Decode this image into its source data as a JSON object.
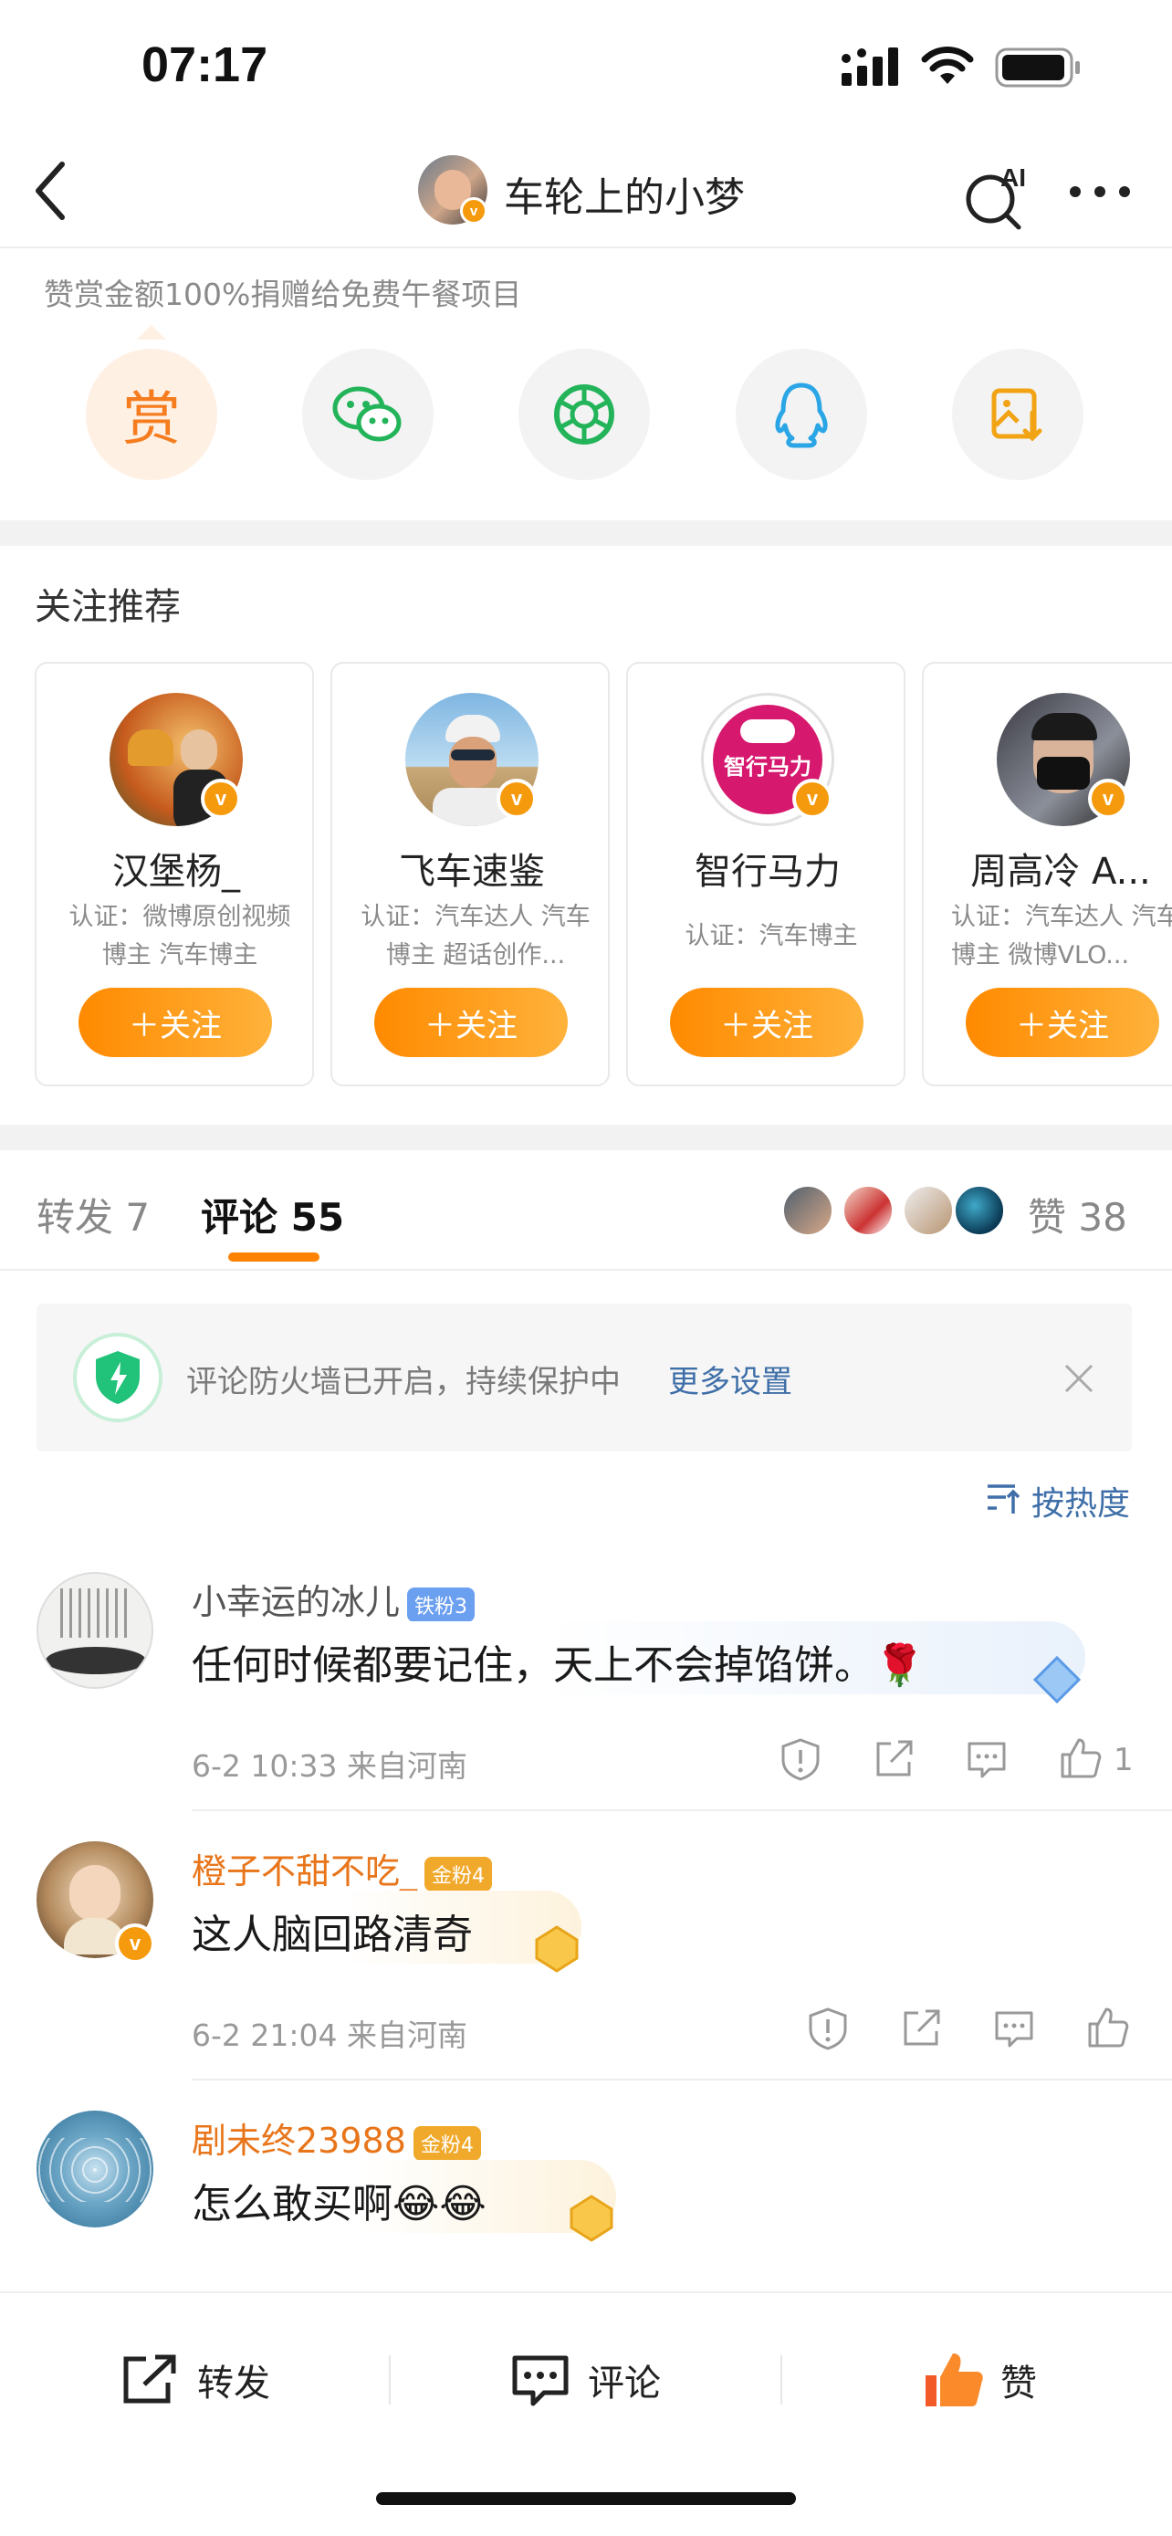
{
  "status": {
    "time": "07:17"
  },
  "header": {
    "title": "车轮上的小梦",
    "ai_label": "AI"
  },
  "reward": {
    "note": "赞赏金额100%捐赠给免费午餐项目",
    "reward_glyph": "赏",
    "share_icons": [
      "reward-icon",
      "wechat-icon",
      "moments-icon",
      "qq-icon",
      "save-image-icon"
    ]
  },
  "recommend": {
    "title": "关注推荐",
    "follow_label": "＋关注",
    "users": [
      {
        "name": "汉堡杨_",
        "desc": "认证：微博原创视频博主 汽车博主"
      },
      {
        "name": "飞车速鉴",
        "desc": "认证：汽车达人 汽车博主 超话创作..."
      },
      {
        "name": "智行马力",
        "desc": "认证：汽车博主",
        "logo": "智行马力"
      },
      {
        "name": "周高冷 A...",
        "desc": "认证：汽车达人 汽车博主 微博VLO..."
      }
    ]
  },
  "tabs": {
    "repost": "转发 7",
    "comment": "评论 55",
    "likes": "赞 38"
  },
  "firewall": {
    "text": "评论防火墙已开启，持续保护中",
    "link": "更多设置"
  },
  "sort": {
    "label": "按热度"
  },
  "comments": [
    {
      "user": "小幸运的冰儿",
      "badge": "铁粉3",
      "text": "任何时候都要记住，天上不会掉馅饼。🌹",
      "meta": "6-2 10:33  来自河南",
      "likes": "1"
    },
    {
      "user": "橙子不甜不吃_",
      "badge": "金粉4",
      "text": "这人脑回路清奇",
      "meta": "6-2 21:04  来自河南",
      "likes": ""
    },
    {
      "user": "剧未终23988",
      "badge": "金粉4",
      "text": "怎么敢买啊😂😂",
      "meta": "",
      "likes": ""
    }
  ],
  "bottom_bar": {
    "repost": "转发",
    "comment": "评论",
    "like": "赞"
  },
  "colors": {
    "accent": "#ff8200",
    "link": "#3f6fa8",
    "orange_name": "#e8751a"
  }
}
